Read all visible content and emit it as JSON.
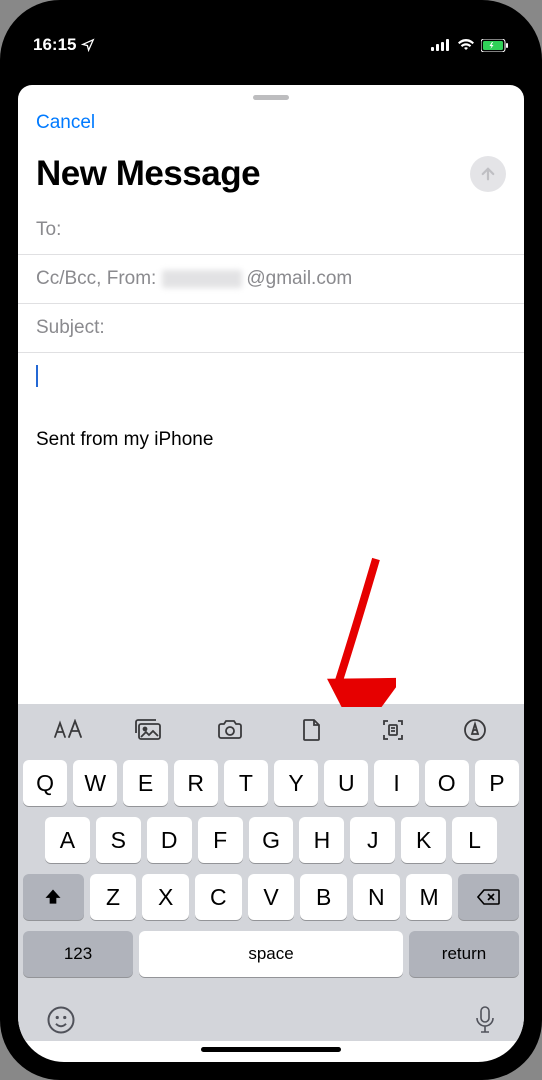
{
  "statusbar": {
    "time": "16:15"
  },
  "compose": {
    "cancel": "Cancel",
    "title": "New Message",
    "to_label": "To:",
    "ccbcc_label": "Cc/Bcc, From:",
    "from_domain": "@gmail.com",
    "subject_label": "Subject:",
    "signature": "Sent from my iPhone"
  },
  "keyboard": {
    "rows": [
      [
        "Q",
        "W",
        "E",
        "R",
        "T",
        "Y",
        "U",
        "I",
        "O",
        "P"
      ],
      [
        "A",
        "S",
        "D",
        "F",
        "G",
        "H",
        "J",
        "K",
        "L"
      ],
      [
        "Z",
        "X",
        "C",
        "V",
        "B",
        "N",
        "M"
      ]
    ],
    "numeric": "123",
    "space": "space",
    "return": "return"
  }
}
